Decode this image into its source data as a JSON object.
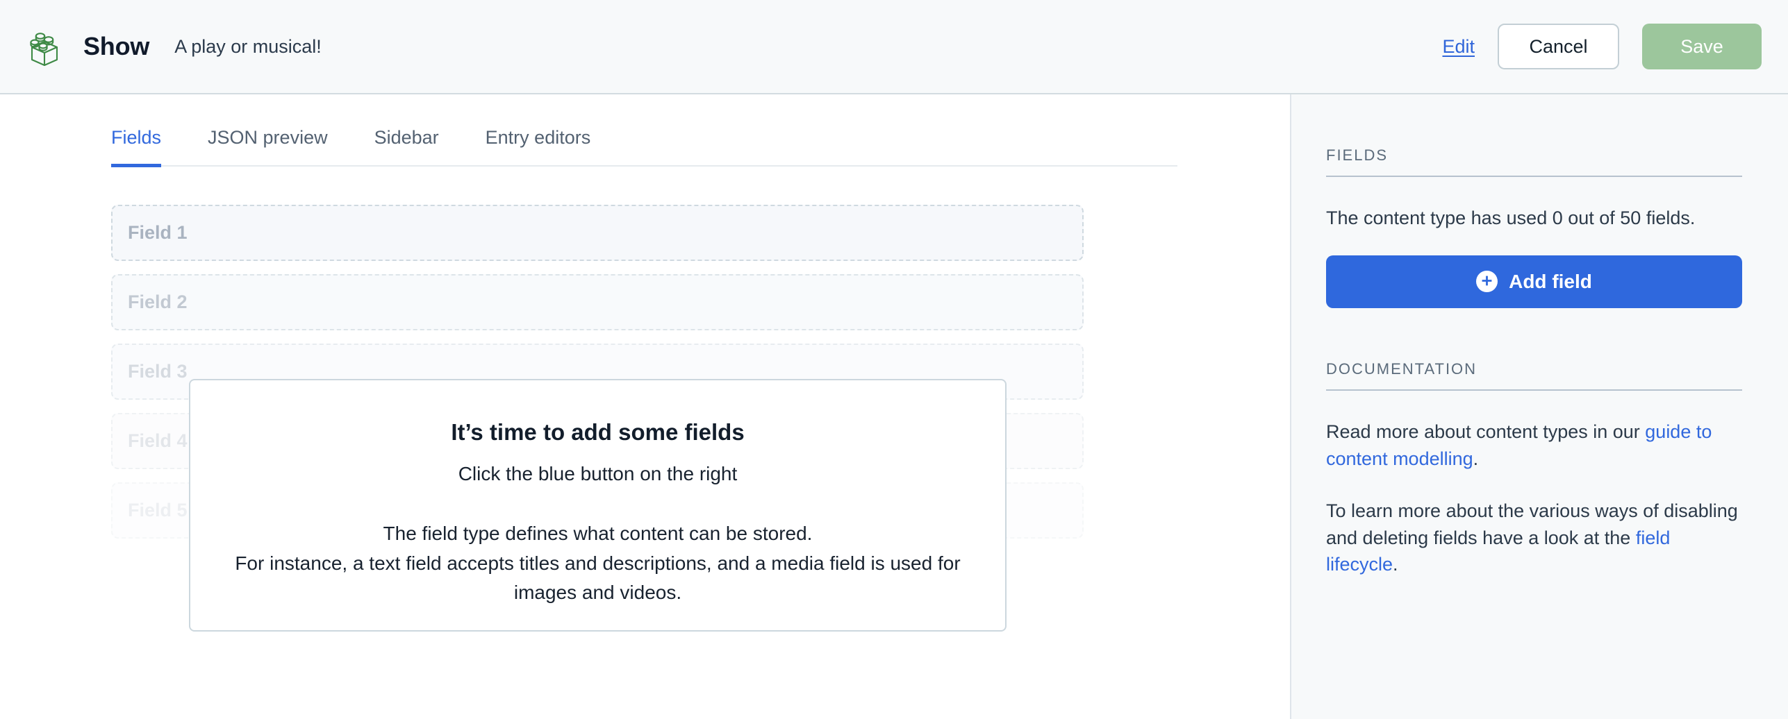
{
  "header": {
    "icon_name": "content-type-brick-icon",
    "icon_color": "#3f8a46",
    "title": "Show",
    "description": "A play or musical!",
    "edit_link": "Edit",
    "cancel_label": "Cancel",
    "save_label": "Save",
    "save_color": "#9cc69c"
  },
  "tabs": [
    {
      "label": "Fields",
      "active": true
    },
    {
      "label": "JSON preview",
      "active": false
    },
    {
      "label": "Sidebar",
      "active": false
    },
    {
      "label": "Entry editors",
      "active": false
    }
  ],
  "ghost_fields": [
    {
      "label": "Field 1"
    },
    {
      "label": "Field 2"
    },
    {
      "label": "Field 3"
    },
    {
      "label": "Field 4"
    },
    {
      "label": "Field 5"
    }
  ],
  "onboarding": {
    "title": "It’s time to add some fields",
    "subtitle": "Click the blue button on the right",
    "body_line_1": "The field type defines what content can be stored.",
    "body_line_2": "For instance, a text field accepts titles and descriptions, and a media field is used for images and videos."
  },
  "sidebar": {
    "fields": {
      "heading": "FIELDS",
      "usage_text": "The content type has used 0 out of 50 fields.",
      "add_field_label": "Add field",
      "add_field_icon": "plus-circle-icon",
      "accent_color": "#2f68dd"
    },
    "documentation": {
      "heading": "DOCUMENTATION",
      "para_1_before": "Read more about content types in our ",
      "para_1_link": "guide to content modelling",
      "para_1_after": ".",
      "para_2_before": "To learn more about the various ways of disabling and deleting fields have a look at the ",
      "para_2_link": "field lifecycle",
      "para_2_after": ".",
      "link_color": "#3168dd"
    }
  }
}
